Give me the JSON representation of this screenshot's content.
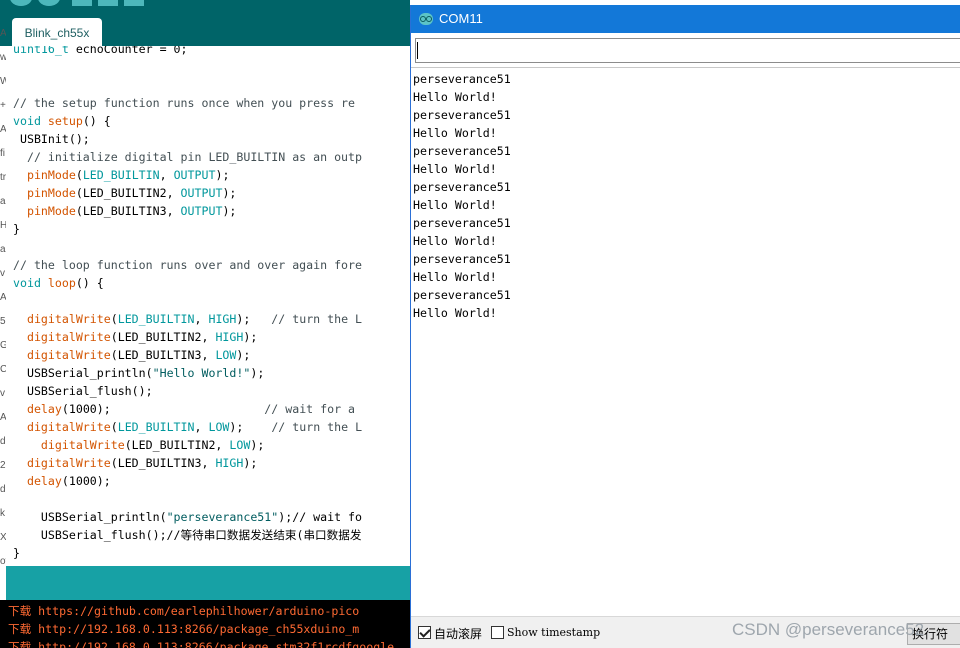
{
  "ide": {
    "tab_label": "Blink_ch55x",
    "code_lines": [
      [
        {
          "t": "uint16_t",
          "c": "kw"
        },
        {
          "t": " echoCounter = 0;",
          "c": ""
        }
      ],
      [],
      [],
      [
        {
          "t": "// the setup function runs once when you press re",
          "c": "cm"
        }
      ],
      [
        {
          "t": "void",
          "c": "kw"
        },
        {
          "t": " ",
          "c": ""
        },
        {
          "t": "setup",
          "c": "fn"
        },
        {
          "t": "() {",
          "c": ""
        }
      ],
      [
        {
          "t": " USBInit();",
          "c": ""
        }
      ],
      [
        {
          "t": "  // initialize digital pin LED_BUILTIN as an outp",
          "c": "cm"
        }
      ],
      [
        {
          "t": "  ",
          "c": ""
        },
        {
          "t": "pinMode",
          "c": "fn"
        },
        {
          "t": "(",
          "c": ""
        },
        {
          "t": "LED_BUILTIN",
          "c": "kw"
        },
        {
          "t": ", ",
          "c": ""
        },
        {
          "t": "OUTPUT",
          "c": "kw"
        },
        {
          "t": ");",
          "c": ""
        }
      ],
      [
        {
          "t": "  ",
          "c": ""
        },
        {
          "t": "pinMode",
          "c": "fn"
        },
        {
          "t": "(LED_BUILTIN2, ",
          "c": ""
        },
        {
          "t": "OUTPUT",
          "c": "kw"
        },
        {
          "t": ");",
          "c": ""
        }
      ],
      [
        {
          "t": "  ",
          "c": ""
        },
        {
          "t": "pinMode",
          "c": "fn"
        },
        {
          "t": "(LED_BUILTIN3, ",
          "c": ""
        },
        {
          "t": "OUTPUT",
          "c": "kw"
        },
        {
          "t": ");",
          "c": ""
        }
      ],
      [
        {
          "t": "}",
          "c": ""
        }
      ],
      [],
      [
        {
          "t": "// the loop function runs over and over again fore",
          "c": "cm"
        }
      ],
      [
        {
          "t": "void",
          "c": "kw"
        },
        {
          "t": " ",
          "c": ""
        },
        {
          "t": "loop",
          "c": "fn"
        },
        {
          "t": "() {",
          "c": ""
        }
      ],
      [],
      [
        {
          "t": "  ",
          "c": ""
        },
        {
          "t": "digitalWrite",
          "c": "fn"
        },
        {
          "t": "(",
          "c": ""
        },
        {
          "t": "LED_BUILTIN",
          "c": "kw"
        },
        {
          "t": ", ",
          "c": ""
        },
        {
          "t": "HIGH",
          "c": "kw"
        },
        {
          "t": ");   ",
          "c": ""
        },
        {
          "t": "// turn the L",
          "c": "cm"
        }
      ],
      [
        {
          "t": "  ",
          "c": ""
        },
        {
          "t": "digitalWrite",
          "c": "fn"
        },
        {
          "t": "(LED_BUILTIN2, ",
          "c": ""
        },
        {
          "t": "HIGH",
          "c": "kw"
        },
        {
          "t": ");",
          "c": ""
        }
      ],
      [
        {
          "t": "  ",
          "c": ""
        },
        {
          "t": "digitalWrite",
          "c": "fn"
        },
        {
          "t": "(LED_BUILTIN3, ",
          "c": ""
        },
        {
          "t": "LOW",
          "c": "kw"
        },
        {
          "t": ");",
          "c": ""
        }
      ],
      [
        {
          "t": "  USBSerial_println(",
          "c": ""
        },
        {
          "t": "\"Hello World!\"",
          "c": "str"
        },
        {
          "t": ");",
          "c": ""
        }
      ],
      [
        {
          "t": "  USBSerial_flush();",
          "c": ""
        }
      ],
      [
        {
          "t": "  ",
          "c": ""
        },
        {
          "t": "delay",
          "c": "fn"
        },
        {
          "t": "(1000);                      ",
          "c": ""
        },
        {
          "t": "// wait for a",
          "c": "cm"
        }
      ],
      [
        {
          "t": "  ",
          "c": ""
        },
        {
          "t": "digitalWrite",
          "c": "fn"
        },
        {
          "t": "(",
          "c": ""
        },
        {
          "t": "LED_BUILTIN",
          "c": "kw"
        },
        {
          "t": ", ",
          "c": ""
        },
        {
          "t": "LOW",
          "c": "kw"
        },
        {
          "t": ");    ",
          "c": ""
        },
        {
          "t": "// turn the L",
          "c": "cm"
        }
      ],
      [
        {
          "t": "    ",
          "c": ""
        },
        {
          "t": "digitalWrite",
          "c": "fn"
        },
        {
          "t": "(LED_BUILTIN2, ",
          "c": ""
        },
        {
          "t": "LOW",
          "c": "kw"
        },
        {
          "t": ");",
          "c": ""
        }
      ],
      [
        {
          "t": "  ",
          "c": ""
        },
        {
          "t": "digitalWrite",
          "c": "fn"
        },
        {
          "t": "(LED_BUILTIN3, ",
          "c": ""
        },
        {
          "t": "HIGH",
          "c": "kw"
        },
        {
          "t": ");",
          "c": ""
        }
      ],
      [
        {
          "t": "  ",
          "c": ""
        },
        {
          "t": "delay",
          "c": "fn"
        },
        {
          "t": "(1000);",
          "c": ""
        }
      ],
      [],
      [
        {
          "t": "    USBSerial_println(",
          "c": ""
        },
        {
          "t": "\"perseverance51\"",
          "c": "str"
        },
        {
          "t": ");// wait fo",
          "c": ""
        }
      ],
      [
        {
          "t": "    USBSerial_flush();//等待串口数据发送结束(串口数据发",
          "c": ""
        }
      ],
      [
        {
          "t": "}",
          "c": ""
        }
      ]
    ],
    "console_lines": [
      {
        "prefix": "下载",
        "text": " https://github.com/earlephilhower/arduino-pico"
      },
      {
        "prefix": "下载",
        "text": " http://192.168.0.113:8266/package_ch55xduino_m"
      },
      {
        "prefix": "下载",
        "text": " http://192.168.0.113:8266/package_stm32f1rcdfgoogle"
      }
    ],
    "edge_chars": [
      "A",
      "w",
      "W",
      "+",
      "A",
      "fi",
      "tr",
      "a",
      "H",
      "a",
      "v",
      "A",
      "5",
      "G",
      "C",
      "v",
      "A",
      "d",
      "2",
      "d",
      "k",
      "X",
      "ot"
    ]
  },
  "serial": {
    "title": "COM11",
    "send_value": "",
    "output_lines": [
      "perseverance51",
      "Hello World!",
      "perseverance51",
      "Hello World!",
      "perseverance51",
      "Hello World!",
      "perseverance51",
      "Hello World!",
      "perseverance51",
      "Hello World!",
      "perseverance51",
      "Hello World!",
      "perseverance51",
      "Hello World!"
    ],
    "autoscroll_label": "自动滚屏",
    "autoscroll_checked": true,
    "timestamp_label": "Show timestamp",
    "timestamp_checked": false,
    "line_ending_value": "换行符"
  },
  "watermark": "CSDN @perseverance52",
  "colors": {
    "ide_teal": "#006468",
    "ide_status": "#17a1a5",
    "keyword": "#00979c",
    "function": "#d35400",
    "titlebar_blue": "#1378d8"
  }
}
